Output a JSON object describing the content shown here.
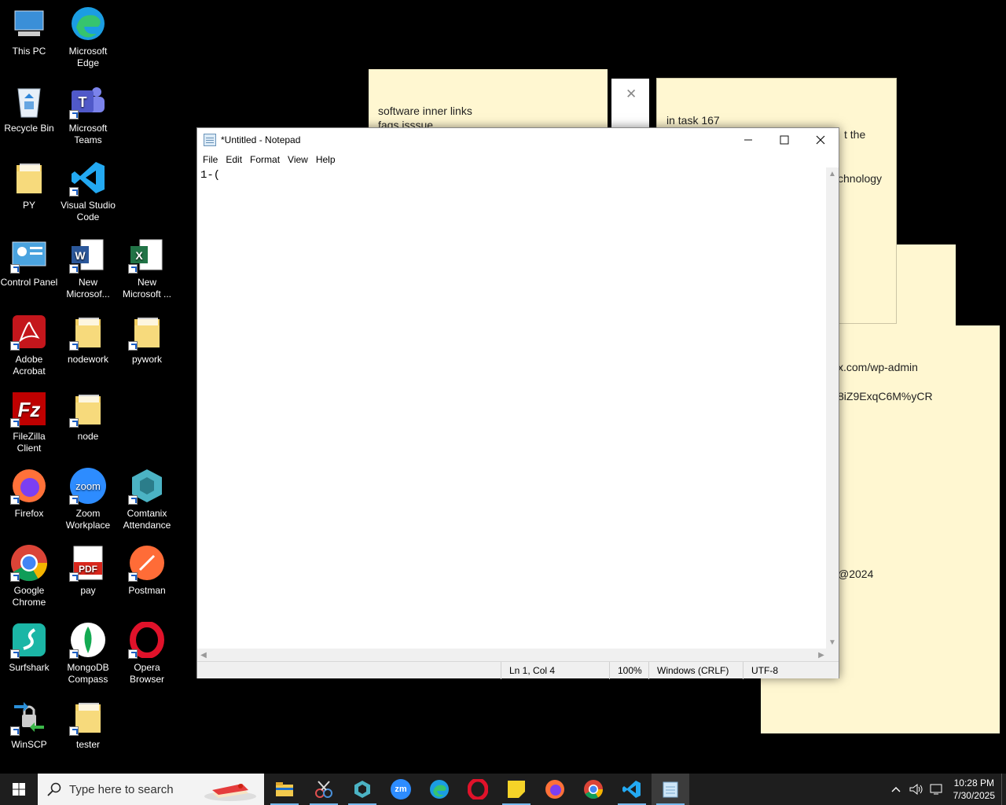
{
  "desktop_icons": [
    {
      "name": "this-pc",
      "label": "This PC",
      "icon": "computer-icon"
    },
    {
      "name": "microsoft-edge",
      "label": "Microsoft Edge",
      "icon": "edge-icon"
    },
    {
      "name": "recycle-bin",
      "label": "Recycle Bin",
      "icon": "recycle-bin-icon"
    },
    {
      "name": "microsoft-teams",
      "label": "Microsoft Teams",
      "icon": "teams-icon"
    },
    {
      "name": "py",
      "label": "PY",
      "icon": "folder-icon"
    },
    {
      "name": "vscode",
      "label": "Visual Studio Code",
      "icon": "vscode-icon"
    },
    {
      "name": "control-panel",
      "label": "Control Panel",
      "icon": "control-panel-icon"
    },
    {
      "name": "new-word",
      "label": "New Microsof...",
      "icon": "word-icon"
    },
    {
      "name": "new-excel",
      "label": "New Microsoft ...",
      "icon": "excel-icon"
    },
    {
      "name": "adobe-acrobat",
      "label": "Adobe Acrobat",
      "icon": "acrobat-icon"
    },
    {
      "name": "nodework",
      "label": "nodework",
      "icon": "folder-icon"
    },
    {
      "name": "pywork",
      "label": "pywork",
      "icon": "folder-icon"
    },
    {
      "name": "filezilla",
      "label": "FileZilla Client",
      "icon": "filezilla-icon"
    },
    {
      "name": "node",
      "label": "node",
      "icon": "folder-icon"
    },
    {
      "name": "firefox",
      "label": "Firefox",
      "icon": "firefox-icon"
    },
    {
      "name": "zoom",
      "label": "Zoom Workplace",
      "icon": "zoom-icon"
    },
    {
      "name": "comtanix",
      "label": "Comtanix Attendance",
      "icon": "comtanix-icon"
    },
    {
      "name": "google-chrome",
      "label": "Google Chrome",
      "icon": "chrome-icon"
    },
    {
      "name": "pay",
      "label": "pay",
      "icon": "pdf-icon"
    },
    {
      "name": "postman",
      "label": "Postman",
      "icon": "postman-icon"
    },
    {
      "name": "surfshark",
      "label": "Surfshark",
      "icon": "surfshark-icon"
    },
    {
      "name": "mongodb-compass",
      "label": "MongoDB Compass",
      "icon": "mongodb-icon"
    },
    {
      "name": "opera",
      "label": "Opera Browser",
      "icon": "opera-icon"
    },
    {
      "name": "winscp",
      "label": "WinSCP",
      "icon": "winscp-icon"
    },
    {
      "name": "tester",
      "label": "tester",
      "icon": "folder-icon"
    }
  ],
  "sticky_notes": {
    "note1": {
      "line1": "software inner links",
      "line2": "faqs isssue"
    },
    "note2": {
      "line1": "in task 167",
      "line2": "t the",
      "line3": "chnology"
    },
    "note3": {
      "line1": "x.com/wp-admin",
      "line2": "8iZ9ExqC6M%yCR",
      "line3": "@2024"
    },
    "close_glyph": "✕"
  },
  "notepad": {
    "title": "*Untitled - Notepad",
    "menu": [
      "File",
      "Edit",
      "Format",
      "View",
      "Help"
    ],
    "content": "1-(",
    "status": {
      "position": "Ln 1, Col 4",
      "zoom": "100%",
      "line_ending": "Windows (CRLF)",
      "encoding": "UTF-8"
    }
  },
  "taskbar": {
    "search_placeholder": "Type here to search",
    "apps": [
      "file-explorer",
      "snipping-tool",
      "comtanix",
      "zoom",
      "edge",
      "opera",
      "sticky-notes",
      "firefox",
      "chrome",
      "vscode",
      "notepad"
    ],
    "zoom_label": "zm",
    "time": "10:28 PM",
    "date": "7/30/2025"
  },
  "colors": {
    "accent": "#76b9ed",
    "sticky": "#fff7d1",
    "taskbar": "#1e1e1e"
  }
}
